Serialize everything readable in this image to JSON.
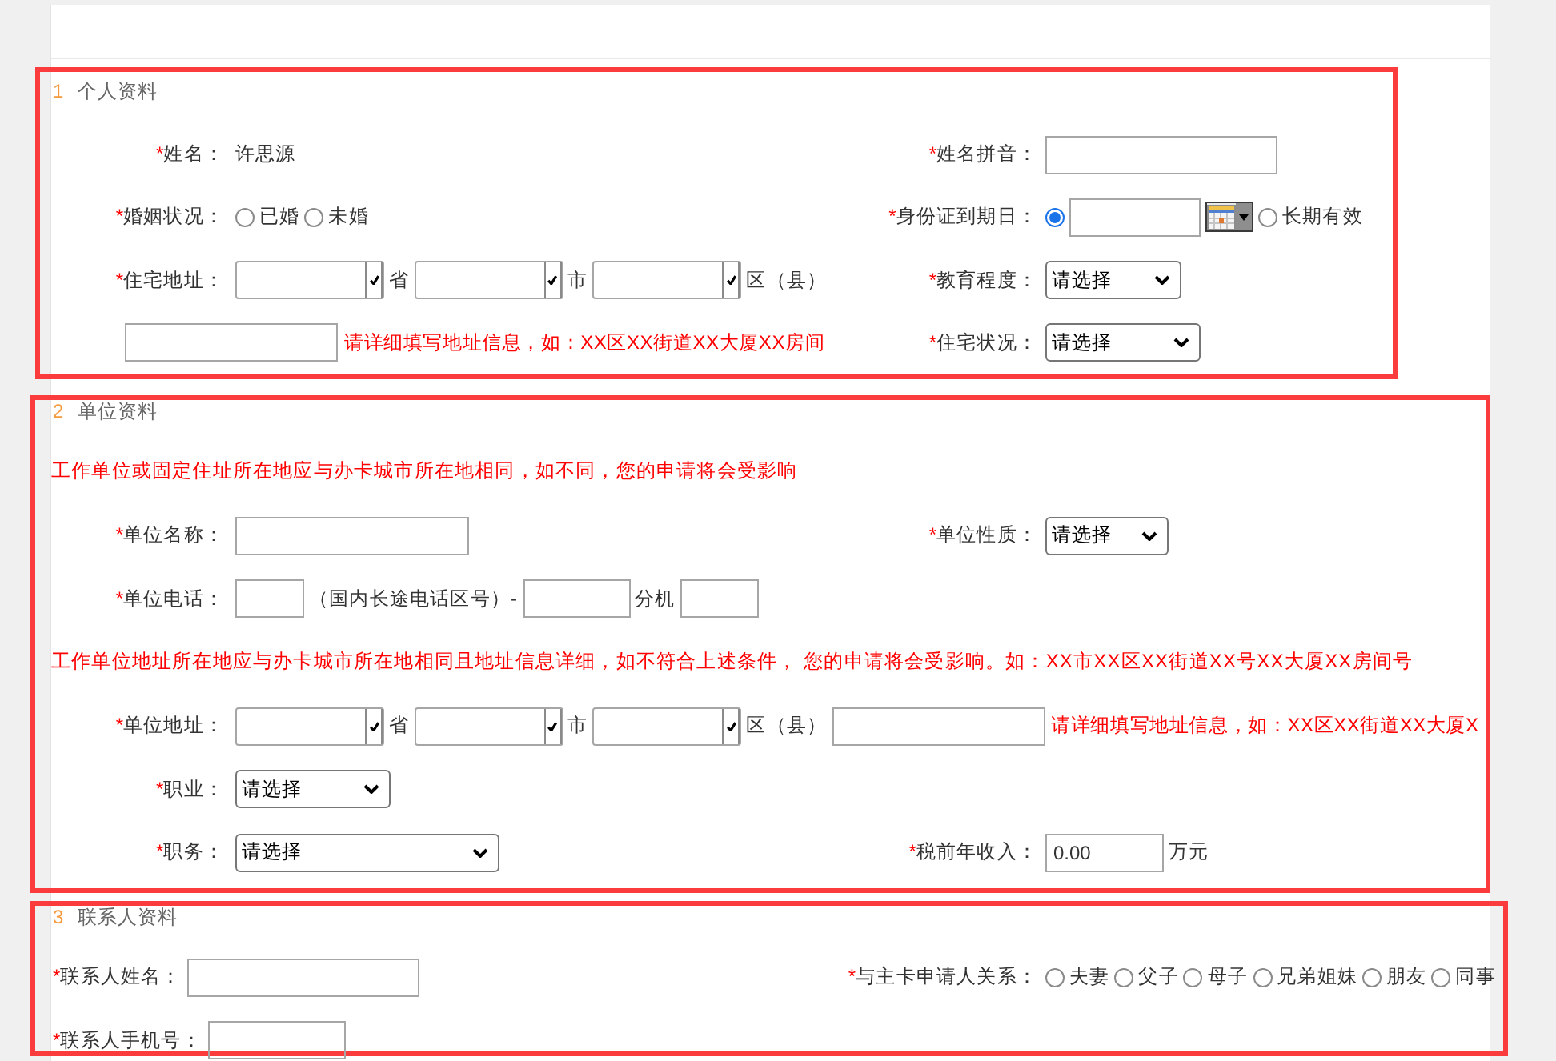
{
  "sections": [
    {
      "number": "1",
      "title": "个人资料",
      "items": [
        {
          "kind": "row",
          "left": {
            "mark": "*",
            "label": "姓名：",
            "parts": [
              {
                "kind": "value",
                "text": "许思源"
              }
            ]
          },
          "right": {
            "mark": "*",
            "label": "姓名拼音：",
            "parts": [
              {
                "kind": "input"
              }
            ]
          }
        },
        {
          "kind": "row",
          "left": {
            "mark": "*",
            "label": "婚姻状况：",
            "parts": [
              {
                "kind": "radio",
                "label": "已婚",
                "selected": false
              },
              {
                "kind": "radio",
                "label": "未婚",
                "selected": false
              }
            ]
          },
          "right": {
            "mark": "*",
            "label": "身份证到期日：",
            "parts": [
              {
                "kind": "radio",
                "selected": true
              },
              {
                "kind": "input"
              },
              {
                "kind": "calendar"
              },
              {
                "kind": "radio",
                "label": "长期有效",
                "selected": false
              }
            ]
          }
        },
        {
          "kind": "row",
          "left": {
            "mark": "*",
            "label": "住宅地址：",
            "parts": [
              {
                "kind": "select"
              },
              {
                "kind": "text",
                "text": "省"
              },
              {
                "kind": "select"
              },
              {
                "kind": "text",
                "text": "市"
              },
              {
                "kind": "select"
              },
              {
                "kind": "text",
                "text": "区（县）"
              }
            ]
          },
          "right": {
            "mark": "*",
            "label": "教育程度：",
            "parts": [
              {
                "kind": "select",
                "value": "请选择"
              }
            ]
          }
        },
        {
          "kind": "row",
          "left": {
            "parts": [
              {
                "kind": "input"
              },
              {
                "kind": "hint",
                "text": "请详细填写地址信息，如：XX区XX街道XX大厦XX房间"
              }
            ]
          },
          "right": {
            "mark": "*",
            "label": "住宅状况：",
            "parts": [
              {
                "kind": "select",
                "value": "请选择"
              }
            ]
          }
        }
      ]
    },
    {
      "number": "2",
      "title": "单位资料",
      "items": [
        {
          "kind": "notice",
          "text": "工作单位或固定住址所在地应与办卡城市所在地相同，如不同，您的申请将会受影响"
        },
        {
          "kind": "row",
          "left": {
            "mark": "*",
            "label": "单位名称：",
            "parts": [
              {
                "kind": "input"
              }
            ]
          },
          "right": {
            "mark": "*",
            "label": "单位性质：",
            "parts": [
              {
                "kind": "select",
                "value": "请选择"
              }
            ]
          }
        },
        {
          "kind": "row",
          "left": {
            "mark": "*",
            "label": "单位电话：",
            "parts": [
              {
                "kind": "input"
              },
              {
                "kind": "text",
                "text": "（国内长途电话区号）-"
              },
              {
                "kind": "input"
              },
              {
                "kind": "text",
                "text": "分机"
              },
              {
                "kind": "input"
              }
            ]
          }
        },
        {
          "kind": "notice",
          "text": "工作单位地址所在地应与办卡城市所在地相同且地址信息详细，如不符合上述条件， 您的申请将会受影响。如：XX市XX区XX街道XX号XX大厦XX房间号"
        },
        {
          "kind": "row",
          "left": {
            "mark": "*",
            "label": "单位地址：",
            "parts": [
              {
                "kind": "select"
              },
              {
                "kind": "text",
                "text": "省"
              },
              {
                "kind": "select"
              },
              {
                "kind": "text",
                "text": "市"
              },
              {
                "kind": "select"
              },
              {
                "kind": "text",
                "text": "区（县）"
              },
              {
                "kind": "input"
              },
              {
                "kind": "hint",
                "text": "请详细填写地址信息，如：XX区XX街道XX大厦X"
              }
            ]
          }
        },
        {
          "kind": "row",
          "left": {
            "mark": "*",
            "label": "职业：",
            "parts": [
              {
                "kind": "select",
                "value": "请选择"
              }
            ]
          }
        },
        {
          "kind": "row",
          "left": {
            "mark": "*",
            "label": "职务：",
            "parts": [
              {
                "kind": "select",
                "value": "请选择"
              }
            ]
          },
          "right": {
            "mark": "*",
            "label": "税前年收入：",
            "parts": [
              {
                "kind": "input",
                "value": "0.00"
              },
              {
                "kind": "text",
                "text": "万元"
              }
            ]
          }
        }
      ]
    },
    {
      "number": "3",
      "title": "联系人资料",
      "items": [
        {
          "kind": "row",
          "left": {
            "mark": "*",
            "label": "联系人姓名：",
            "parts": [
              {
                "kind": "input"
              }
            ]
          },
          "right": {
            "mark": "*",
            "label": "与主卡申请人关系：",
            "parts": [
              {
                "kind": "radio",
                "label": "夫妻",
                "selected": false
              },
              {
                "kind": "radio",
                "label": "父子",
                "selected": false
              },
              {
                "kind": "radio",
                "label": "母子",
                "selected": false
              },
              {
                "kind": "radio",
                "label": "兄弟姐妹",
                "selected": false
              },
              {
                "kind": "radio",
                "label": "朋友",
                "selected": false
              },
              {
                "kind": "radio",
                "label": "同事",
                "selected": false
              }
            ]
          }
        },
        {
          "kind": "row",
          "left": {
            "mark": "*",
            "label": "联系人手机号：",
            "parts": [
              {
                "kind": "input"
              }
            ]
          }
        }
      ]
    }
  ]
}
